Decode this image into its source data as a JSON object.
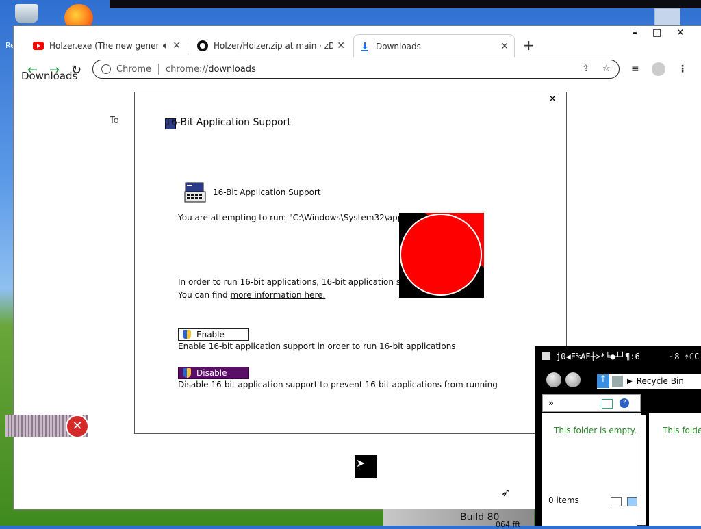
{
  "desktop": {
    "left_label": "Re",
    "icons": [
      "recycle-bin-icon",
      "firefox-icon"
    ]
  },
  "browser": {
    "tabs": [
      {
        "label": "Holzer.exe (The new generati",
        "icon": "youtube-icon"
      },
      {
        "label": "Holzer/Holzer.zip at main · zDom",
        "icon": "github-icon"
      },
      {
        "label": "Downloads",
        "icon": "download-icon"
      }
    ],
    "window_controls": {
      "minimize": "–",
      "maximize": "□",
      "close": "✕"
    },
    "omnibox": {
      "site_label": "Chrome",
      "url_scheme": "chrome://",
      "url_path": "downloads"
    },
    "page": {
      "title": "Downloads",
      "fragment": "To"
    }
  },
  "dialog": {
    "title": "16-Bit Application Support",
    "close": "✕",
    "app_label": "16-Bit Application Support",
    "attempt_text": "You are attempting to run: \"C:\\Windows\\System32\\append.e",
    "order_text": "In order to run 16-bit applications, 16-bit application support",
    "find_prefix": "You can find",
    "link_text": "more information here.",
    "enable": {
      "label": "Enable",
      "description": "Enable 16-bit application support in order to run 16-bit applications"
    },
    "disable": {
      "label": "Disable",
      "description": "Disable 16-bit application support to prevent 16-bit applications from running"
    },
    "colors": {
      "disable_bg": "#5a0f67",
      "overlay_circle": "#ff0000"
    }
  },
  "artifacts": {
    "build_text": "Build 80",
    "build_sub": "064 fft"
  },
  "explorer": {
    "title": "ϳ0◀F%AE┼>*╘●┴┘¶:6",
    "title_right": "┘8 ↑ℂC",
    "breadcrumb": "Recycle Bin",
    "more": "»",
    "empty_text": "This folder is empty.",
    "empty_text_2": "This folder",
    "items_count": "0 items"
  }
}
